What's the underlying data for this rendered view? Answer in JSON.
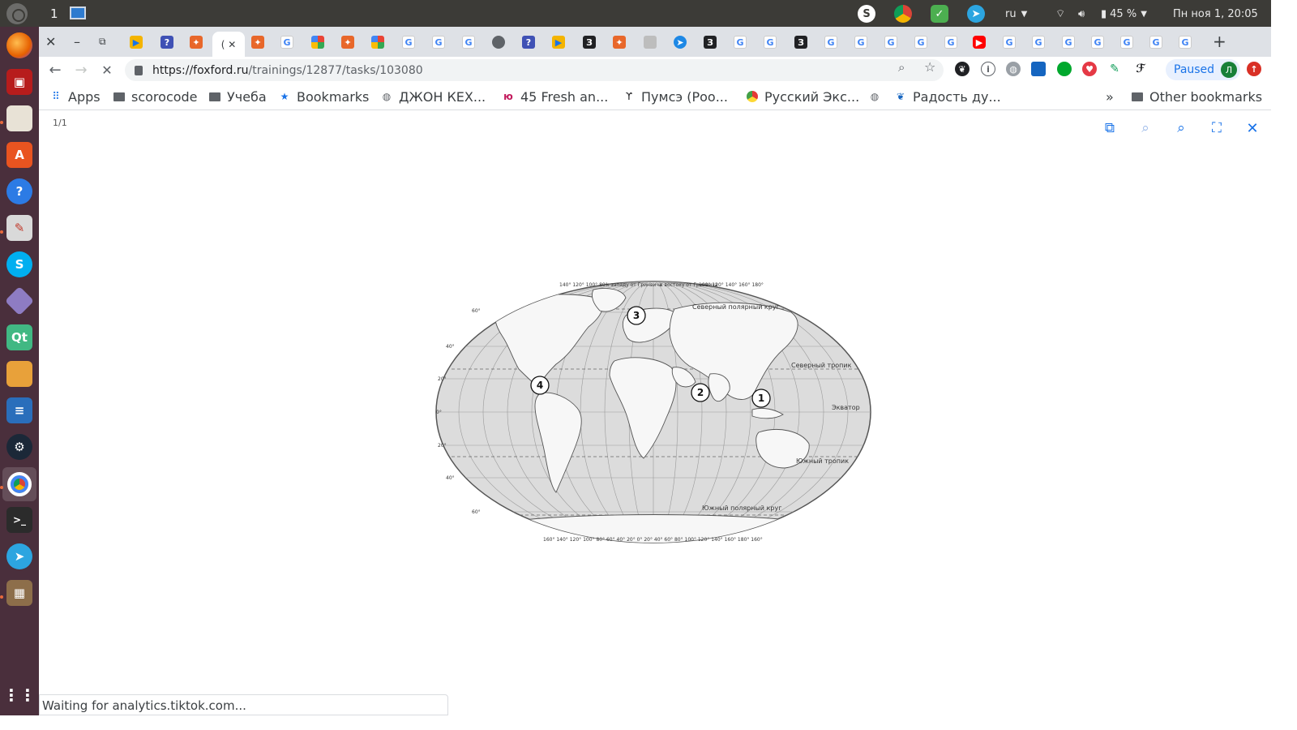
{
  "top_panel": {
    "workspace": "1",
    "keyboard_layout": "ru",
    "battery": "45 %",
    "datetime": "Пн ноя  1, 20:05"
  },
  "browser": {
    "url_host": "https://foxford.ru",
    "url_path": "/trainings/12877/tasks/103080",
    "profile_status": "Paused",
    "profile_initial": "Л"
  },
  "bookmarks": {
    "apps": "Apps",
    "items": [
      "scorocode",
      "Учеба",
      "Bookmarks",
      "ДЖОН КЕХ...",
      "45 Fresh an...",
      "Пумсэ (Роо...",
      "Русский Экс...",
      "Радость ду..."
    ],
    "overflow": "»",
    "other": "Other bookmarks"
  },
  "viewer": {
    "page_counter": "1/1"
  },
  "map": {
    "markers": [
      "1",
      "2",
      "3",
      "4"
    ],
    "labels": {
      "arctic": "Северный полярный круг",
      "tropic_north": "Северный тропик",
      "equator": "Экватор",
      "tropic_south": "Южный тропик",
      "antarctic": "Южный полярный круг",
      "west": "к западу от Гринвича",
      "east": "к востоку от Гринвича",
      "top_ticks_left": "140° 120° 100° 80°",
      "top_ticks_right": "100° 120° 140° 160° 180°",
      "bottom_ticks": "160° 140° 120° 100° 80° 60° 40° 20° 0° 20° 40° 60° 80° 100° 120° 140° 160° 180° 160°"
    },
    "lat_marks": [
      "60°",
      "40°",
      "20°",
      "0°",
      "20°",
      "40°",
      "60°"
    ]
  },
  "status": {
    "text": "Waiting for analytics.tiktok.com..."
  }
}
